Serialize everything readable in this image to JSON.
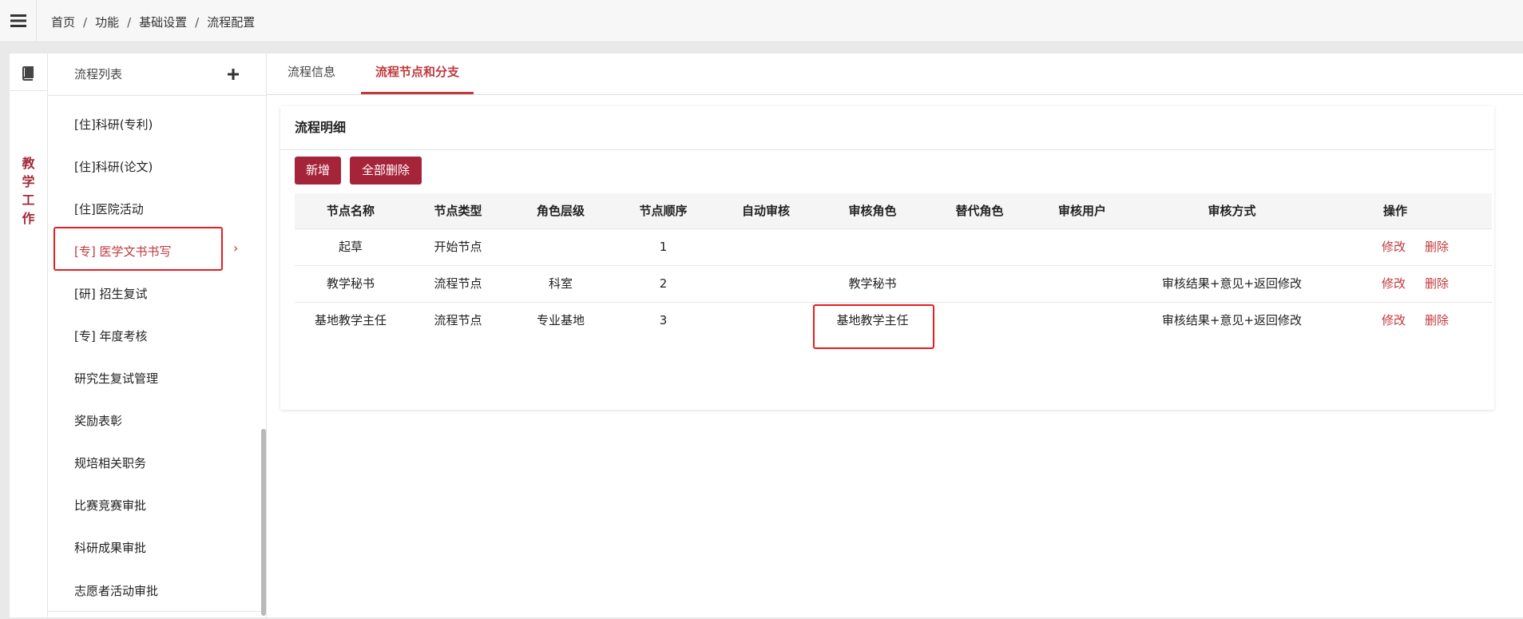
{
  "breadcrumb": [
    "首页",
    "功能",
    "基础设置",
    "流程配置"
  ],
  "rail": {
    "label_chars": [
      "教",
      "学",
      "工",
      "作"
    ]
  },
  "flow_list": {
    "title": "流程列表",
    "items": [
      "[住]科研(专利)",
      "[住]科研(论文)",
      "[住]医院活动",
      "[专] 医学文书书写",
      "[研] 招生复试",
      "[专] 年度考核",
      "研究生复试管理",
      "奖励表彰",
      "规培相关职务",
      "比赛竞赛审批",
      "科研成果审批",
      "志愿者活动审批"
    ],
    "active_index": 3
  },
  "tabs": [
    "流程信息",
    "流程节点和分支"
  ],
  "active_tab": 1,
  "card": {
    "title": "流程明细",
    "add_label": "新增",
    "delete_all_label": "全部删除"
  },
  "table": {
    "headers": [
      "节点名称",
      "节点类型",
      "角色层级",
      "节点顺序",
      "自动审核",
      "审核角色",
      "替代角色",
      "审核用户",
      "审核方式",
      "操作"
    ],
    "rows": [
      [
        "起草",
        "开始节点",
        "",
        "1",
        "",
        "",
        "",
        "",
        ""
      ],
      [
        "教学秘书",
        "流程节点",
        "科室",
        "2",
        "",
        "教学秘书",
        "",
        "",
        "审核结果+意见+返回修改"
      ],
      [
        "基地教学主任",
        "流程节点",
        "专业基地",
        "3",
        "",
        "基地教学主任",
        "",
        "",
        "审核结果+意见+返回修改"
      ]
    ],
    "edit_label": "修改",
    "delete_label": "删除"
  },
  "colors": {
    "accent": "#a6243a",
    "link": "#c0393b",
    "highlight_box": "#e81d1d"
  },
  "icons": {
    "menu": "hamburger-icon",
    "rail": "book-icon",
    "add": "plus-icon",
    "active_item": "chevron-right-icon"
  }
}
